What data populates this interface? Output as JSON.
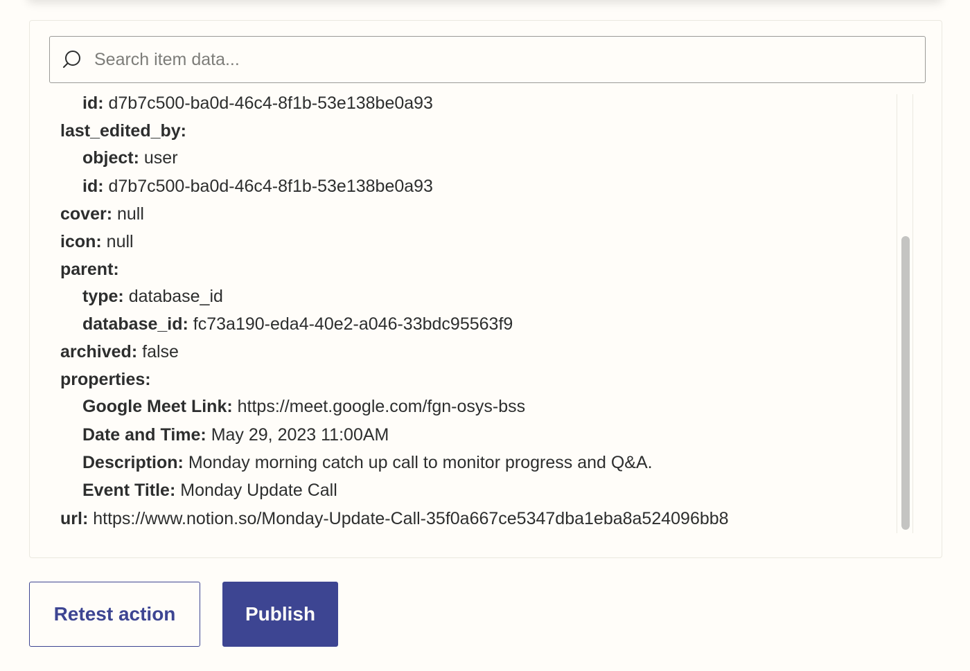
{
  "search": {
    "placeholder": "Search item data..."
  },
  "data_rows": [
    {
      "level": 1,
      "key": "id:",
      "value": "d7b7c500-ba0d-46c4-8f1b-53e138be0a93"
    },
    {
      "level": 0,
      "key": "last_edited_by:",
      "value": ""
    },
    {
      "level": 1,
      "key": "object:",
      "value": "user"
    },
    {
      "level": 1,
      "key": "id:",
      "value": "d7b7c500-ba0d-46c4-8f1b-53e138be0a93"
    },
    {
      "level": 0,
      "key": "cover:",
      "value": "null"
    },
    {
      "level": 0,
      "key": "icon:",
      "value": "null"
    },
    {
      "level": 0,
      "key": "parent:",
      "value": ""
    },
    {
      "level": 1,
      "key": "type:",
      "value": "database_id"
    },
    {
      "level": 1,
      "key": "database_id:",
      "value": "fc73a190-eda4-40e2-a046-33bdc95563f9"
    },
    {
      "level": 0,
      "key": "archived:",
      "value": "false"
    },
    {
      "level": 0,
      "key": "properties:",
      "value": ""
    },
    {
      "level": 1,
      "key": "Google Meet Link:",
      "value": "https://meet.google.com/fgn-osys-bss"
    },
    {
      "level": 1,
      "key": "Date and Time:",
      "value": "May 29, 2023 11:00AM"
    },
    {
      "level": 1,
      "key": "Description:",
      "value": "Monday morning catch up call to monitor progress and Q&A."
    },
    {
      "level": 1,
      "key": "Event Title:",
      "value": "Monday Update Call"
    },
    {
      "level": 0,
      "key": "url:",
      "value": "https://www.notion.so/Monday-Update-Call-35f0a667ce5347dba1eba8a524096bb8"
    }
  ],
  "buttons": {
    "retest_label": "Retest action",
    "publish_label": "Publish"
  },
  "colors": {
    "accent": "#3d4592",
    "background": "#fffdf9",
    "scrollbar_thumb": "#c4c4c2"
  },
  "icons": {
    "search": "search-icon"
  }
}
